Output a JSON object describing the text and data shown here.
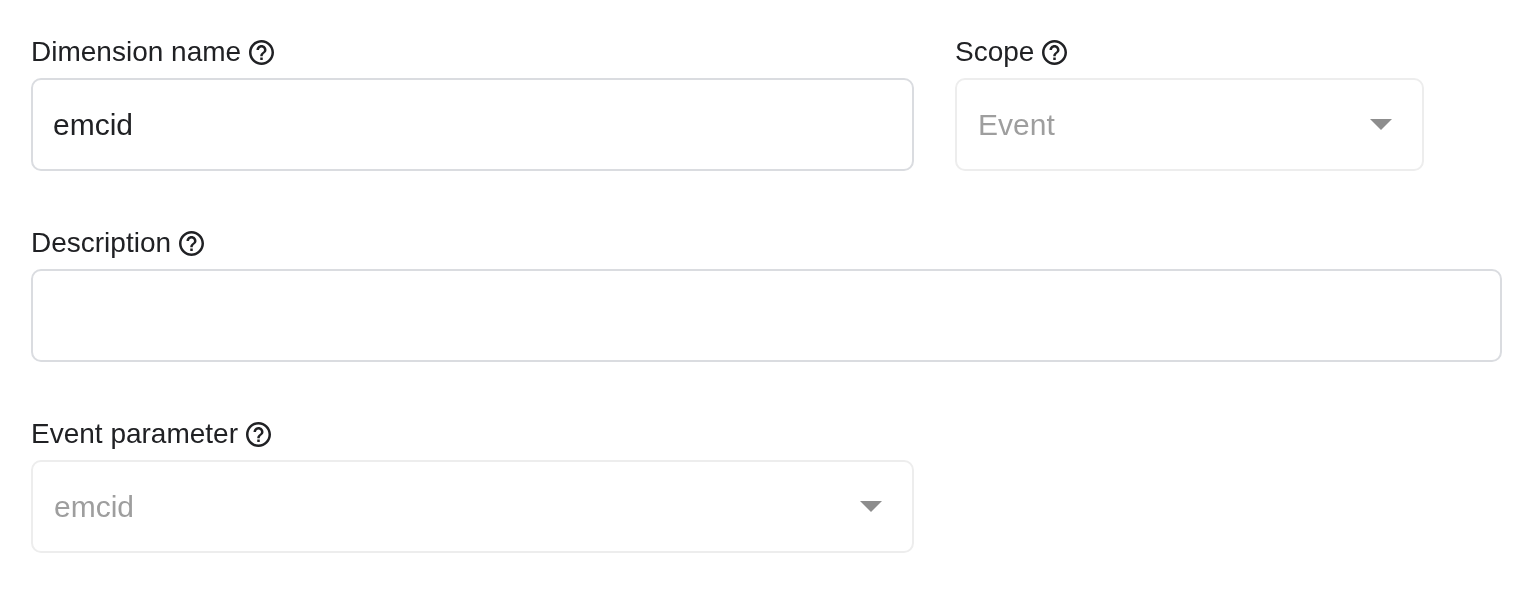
{
  "rows": [
    {
      "fields": [
        {
          "label": "Dimension name",
          "kind": "text",
          "value": "emcid",
          "disabled": false
        },
        {
          "label": "Scope",
          "kind": "select",
          "value": "Event",
          "disabled": true
        }
      ]
    },
    {
      "fields": [
        {
          "label": "Description",
          "kind": "text",
          "disabled": false
        }
      ]
    },
    {
      "fields": [
        {
          "label": "Event parameter",
          "kind": "select",
          "value": "emcid",
          "disabled": true
        }
      ]
    }
  ]
}
